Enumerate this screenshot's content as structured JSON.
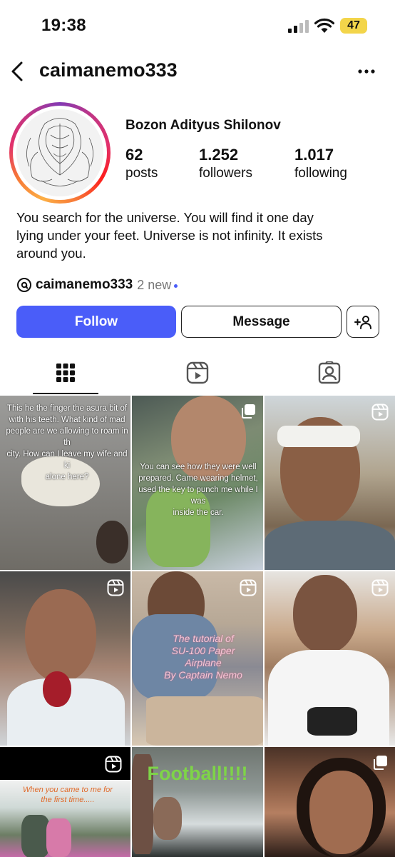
{
  "status_bar": {
    "time": "19:38",
    "battery": "47"
  },
  "header": {
    "username": "caimanemo333"
  },
  "profile": {
    "display_name": "Bozon Adityus Shilonov",
    "stats": [
      {
        "value": "62",
        "label": "posts"
      },
      {
        "value": "1.252",
        "label": "followers"
      },
      {
        "value": "1.017",
        "label": "following"
      }
    ],
    "bio_lines": [
      "You search for the universe. You will find it one day",
      "lying under your feet. Universe is not infinity. It exists",
      "around you."
    ],
    "threads": {
      "handle": "caimanemo333",
      "new_label": "2 new"
    }
  },
  "actions": {
    "follow": "Follow",
    "message": "Message"
  },
  "tabs": [
    "grid-icon",
    "reels-icon",
    "tagged-icon"
  ],
  "posts": [
    {
      "type": "photo",
      "caption_lines": [
        "This he the finger the asura bit of",
        "with his teeth. What kind of mad",
        "people are we allowing to roam in th",
        "city. How can I leave my wife and ki",
        "alone here?"
      ]
    },
    {
      "type": "carousel",
      "caption_lines": [
        "You can see how they were well",
        "prepared. Came wearing helmet,",
        "used the key to punch me while I was",
        "inside the car."
      ]
    },
    {
      "type": "reel"
    },
    {
      "type": "reel"
    },
    {
      "type": "reel",
      "caption_lines": [
        "The tutorial of",
        "SU-100 Paper",
        "Airplane",
        "By Captain Nemo"
      ]
    },
    {
      "type": "reel"
    },
    {
      "type": "reel",
      "caption_lines": [
        "When you came to me for",
        "the first time....."
      ]
    },
    {
      "type": "photo",
      "caption_lines": [
        "Football!!!!"
      ]
    },
    {
      "type": "carousel"
    }
  ],
  "colors": {
    "follow_button": "#4a5df9",
    "story_ring": [
      "#fcaf45",
      "#e1306c",
      "#833ab4"
    ]
  }
}
